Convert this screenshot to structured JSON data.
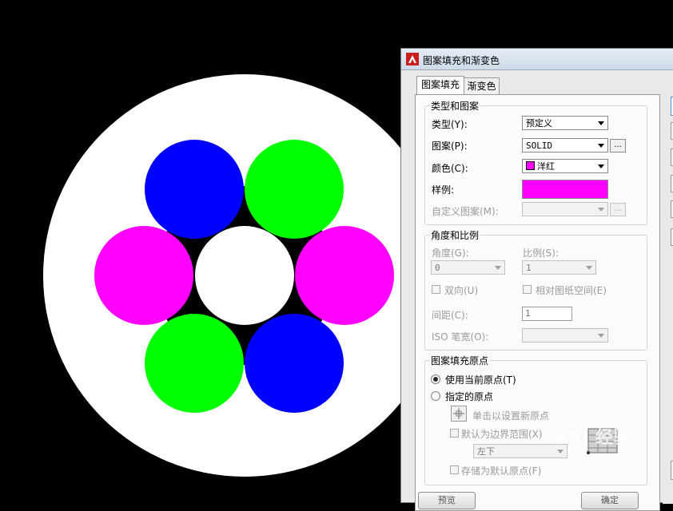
{
  "drawing": {
    "background": "#000000",
    "outer_circle_color": "#ffffff",
    "center_circle_color": "#ffffff",
    "colors": {
      "blue": "#0000ff",
      "green": "#00ff00",
      "magenta": "#ff00ff"
    }
  },
  "dialog": {
    "title": "图案填充和渐变色",
    "tabs": [
      "图案填充",
      "渐变色"
    ],
    "type_pattern": {
      "group_title": "类型和图案",
      "type_label": "类型(Y):",
      "type_value": "预定义",
      "pattern_label": "图案(P):",
      "pattern_value": "SOLID",
      "pattern_browse": "...",
      "color_label": "颜色(C):",
      "color_value": "洋红",
      "color_swatch": "#ff00ff",
      "sample_label": "样例:",
      "sample_color": "#ff00ff",
      "custom_label": "自定义图案(M):",
      "custom_browse": "..."
    },
    "angle_scale": {
      "group_title": "角度和比例",
      "angle_label": "角度(G):",
      "angle_value": "0",
      "scale_label": "比例(S):",
      "scale_value": "1",
      "double_label": "双向(U)",
      "relative_label": "相对图纸空间(E)",
      "spacing_label": "间距(C):",
      "spacing_value": "1",
      "iso_label": "ISO 笔宽(O):"
    },
    "origin": {
      "group_title": "图案填充原点",
      "use_current_label": "使用当前原点(T)",
      "specified_label": "指定的原点",
      "click_set_label": "单击以设置新原点",
      "default_boundary_label": "默认为边界范围(X)",
      "position_value": "左下",
      "store_default_label": "存储为默认原点(F)"
    },
    "bottom_buttons": [
      "预览",
      "确定"
    ]
  },
  "watermark": {
    "text": "Bai 经验",
    "sub": "jingyan.baidu.com"
  }
}
